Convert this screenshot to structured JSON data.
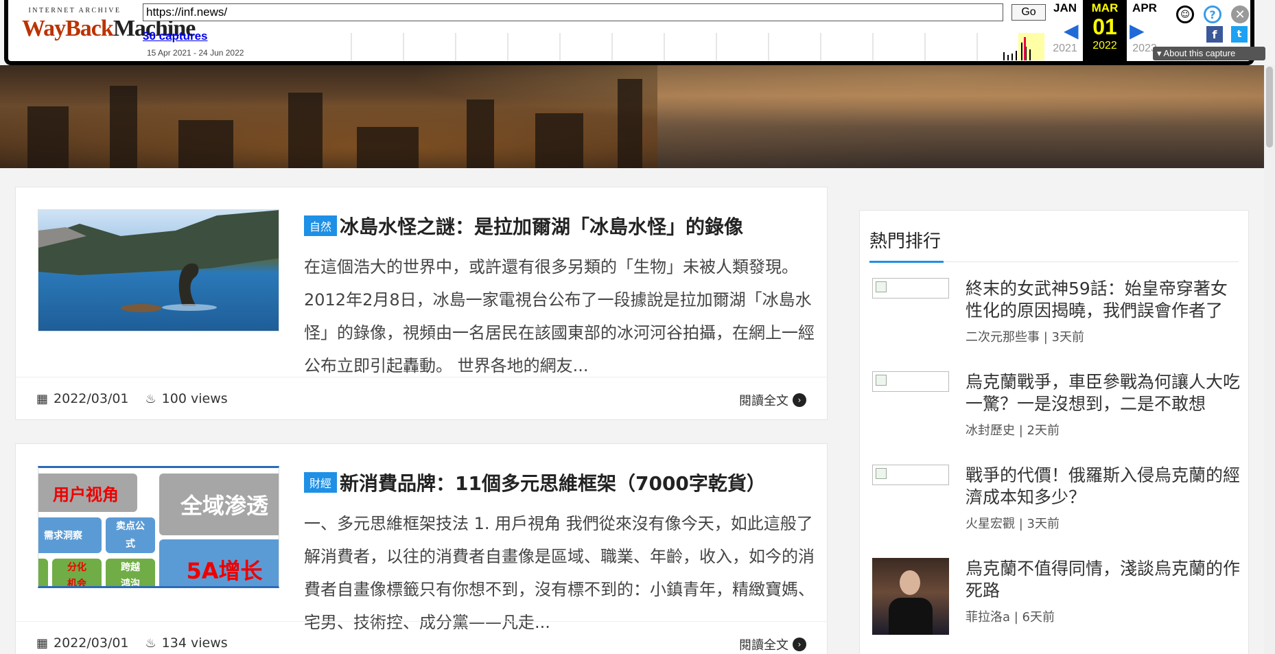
{
  "wayback": {
    "logo_top": "INTERNET ARCHIVE",
    "logo_red": "WayBack",
    "logo_black": "Machine",
    "url": "https://inf.news/",
    "go_label": "Go",
    "captures_label": "30 captures",
    "range": "15 Apr 2021 - 24 Jun 2022",
    "months": {
      "prev": "JAN",
      "current": "MAR",
      "next": "APR"
    },
    "day": "01",
    "years": {
      "prev": "2021",
      "current": "2022",
      "next": "2023"
    },
    "about_label": "About this capture"
  },
  "articles": [
    {
      "tag": "自然",
      "title": "冰島水怪之謎：是拉加爾湖「冰島水怪」的錄像",
      "excerpt": "在這個浩大的世界中，或許還有很多另類的「生物」未被人類發現。 2012年2月8日，冰島一家電視台公布了一段據說是拉加爾湖「冰島水怪」的錄像，視頻由一名居民在該國東部的冰河河谷拍攝，在網上一經公布立即引起轟動。 世界各地的網友...",
      "date": "2022/03/01",
      "views": "100 views",
      "more": "閱讀全文"
    },
    {
      "tag": "財經",
      "title": "新消費品牌：11個多元思維框架（7000字乾貨）",
      "excerpt": "一、多元思維框架技法 1. 用戶視角 我們從來沒有像今天，如此這般了解消費者，以往的消費者自畫像是區域、職業、年齡，收入，如今的消費者自畫像標籤只有你想不到，沒有標不到的：小鎮青年，精緻寶媽、宅男、技術控、成分黨——凡走...",
      "date": "2022/03/01",
      "views": "134 views",
      "more": "閱讀全文",
      "thumb_text": {
        "a": "用户视角",
        "b": "全域渗透",
        "c": "需求洞察",
        "d": "卖点公式",
        "e": "分化机会",
        "f": "跨越鸿沟",
        "g": "5A增长"
      }
    }
  ],
  "sidebar": {
    "title": "熱門排行",
    "items": [
      {
        "title": "終末的女武神59話：始皇帝穿著女性化的原因揭曉，我們誤會作者了",
        "source": "二次元那些事 | 3天前"
      },
      {
        "title": "烏克蘭戰爭，車臣參戰為何讓人大吃一驚？一是沒想到，二是不敢想",
        "source": "冰封歷史 | 2天前"
      },
      {
        "title": "戰爭的代價！俄羅斯入侵烏克蘭的經濟成本知多少？",
        "source": "火星宏觀 | 3天前"
      },
      {
        "title": "烏克蘭不值得同情，淺談烏克蘭的作死路",
        "source": "菲拉洛a | 6天前"
      }
    ]
  }
}
